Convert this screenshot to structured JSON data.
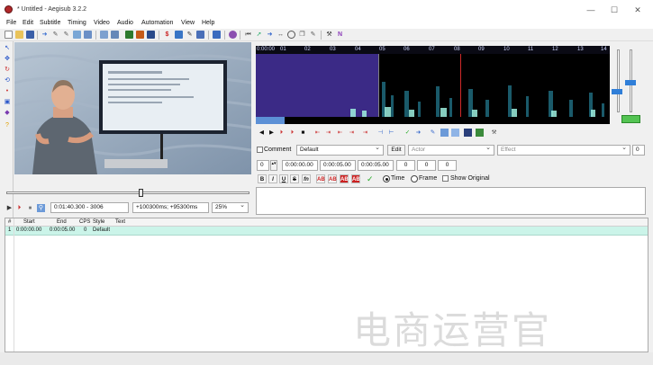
{
  "window": {
    "title": "* Untitled - Aegisub 3.2.2",
    "min": "—",
    "max": "☐",
    "close": "✕"
  },
  "menu": [
    "File",
    "Edit",
    "Subtitle",
    "Timing",
    "Video",
    "Audio",
    "Automation",
    "View",
    "Help"
  ],
  "toolbar_icons": [
    "new-file-icon",
    "open-file-icon",
    "save-icon",
    "save-as-icon",
    "jump-icon",
    "styles-icon",
    "properties-icon",
    "attachments-icon",
    "fonts-icon",
    "translation-icon",
    "spellcheck-icon",
    "assistant-icon",
    "timing-icon",
    "kanji-icon",
    "shift-times-icon",
    "resample-icon",
    "select-icon",
    "sort-icon",
    "dummy-icon",
    "color-icon",
    "automation-icon",
    "options-icon",
    "tag-icon",
    "find-icon",
    "replace-icon",
    "lua-icon",
    "help-icon"
  ],
  "video": {
    "time_display": "0:01:40.300 - 3006",
    "offset_display": "+100300ms; +95300ms",
    "zoom": "25%"
  },
  "audio": {
    "ruler_labels": [
      "0:00:00",
      "01",
      "02",
      "03",
      "04",
      "05",
      "06",
      "07",
      "08",
      "09",
      "10",
      "11",
      "12",
      "13",
      "14"
    ]
  },
  "edit": {
    "comment_label": "Comment",
    "style": "Default",
    "edit_button": "Edit",
    "actor_placeholder": "Actor",
    "effect_placeholder": "Effect",
    "margin_value": "0",
    "layer": "0",
    "start_time": "0:00:00.00",
    "end_time": "0:00:05.00",
    "duration": "0:00:05.00",
    "margin_l": "0",
    "margin_r": "0",
    "margin_v": "0",
    "fmt_bold": "B",
    "fmt_italic": "I",
    "fmt_underline": "U",
    "fmt_strike": "S",
    "fmt_font": "fn",
    "fmt_color1": "AB",
    "fmt_color2": "AB",
    "fmt_color3": "AB",
    "fmt_color4": "AB",
    "time_label": "Time",
    "frame_label": "Frame",
    "show_original_label": "Show Original"
  },
  "grid": {
    "headers": [
      "#",
      "Start",
      "End",
      "CPS",
      "Style",
      "Text"
    ],
    "rows": [
      {
        "num": "1",
        "start": "0:00:00.00",
        "end": "0:00:05.00",
        "cps": "0",
        "style": "Default",
        "text": ""
      }
    ]
  },
  "watermark": "电商运营官",
  "colors": {
    "accent": "#b0282a",
    "grid_selected": "#cbf4e9",
    "audio_bg": "#000000",
    "spectrum_purple": "#3b2a86"
  }
}
